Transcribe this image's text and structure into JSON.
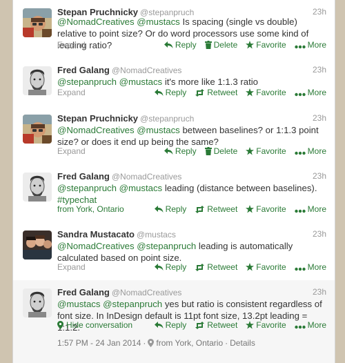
{
  "tweets": [
    {
      "name": "Stepan Pruchnicky",
      "handle": "@stepanpruch",
      "time": "23h",
      "parts": [
        {
          "t": "@NomadCreatives",
          "m": true
        },
        {
          "t": " ",
          "m": false
        },
        {
          "t": "@mustacs",
          "m": true
        },
        {
          "t": " Is spacing (single vs double) relative to point size? Or do word processors use some kind of leading ratio?",
          "m": false
        }
      ],
      "expand": "Expand",
      "actions": [
        "Reply",
        "Delete",
        "Favorite",
        "More"
      ]
    },
    {
      "name": "Fred Galang",
      "handle": "@NomadCreatives",
      "time": "23h",
      "parts": [
        {
          "t": "@stepanpruch",
          "m": true
        },
        {
          "t": " ",
          "m": false
        },
        {
          "t": "@mustacs",
          "m": true
        },
        {
          "t": " it's more like 1:1.3 ratio",
          "m": false
        }
      ],
      "expand": "Expand",
      "actions": [
        "Reply",
        "Retweet",
        "Favorite",
        "More"
      ]
    },
    {
      "name": "Stepan Pruchnicky",
      "handle": "@stepanpruch",
      "time": "23h",
      "parts": [
        {
          "t": "@NomadCreatives",
          "m": true
        },
        {
          "t": " ",
          "m": false
        },
        {
          "t": "@mustacs",
          "m": true
        },
        {
          "t": " between baselines? or 1:1.3 point size? or does it end up being the same?",
          "m": false
        }
      ],
      "expand": "Expand",
      "actions": [
        "Reply",
        "Delete",
        "Favorite",
        "More"
      ]
    },
    {
      "name": "Fred Galang",
      "handle": "@NomadCreatives",
      "time": "23h",
      "parts": [
        {
          "t": "@stepanpruch",
          "m": true
        },
        {
          "t": " ",
          "m": false
        },
        {
          "t": "@mustacs",
          "m": true
        },
        {
          "t": " leading (distance between baselines). ",
          "m": false
        },
        {
          "t": "#typechat",
          "m": true
        }
      ],
      "expand": "from York, Ontario",
      "actions": [
        "Reply",
        "Retweet",
        "Favorite",
        "More"
      ]
    },
    {
      "name": "Sandra Mustacato",
      "handle": "@mustacs",
      "time": "23h",
      "parts": [
        {
          "t": "@NomadCreatives",
          "m": true
        },
        {
          "t": " ",
          "m": false
        },
        {
          "t": "@stepanpruch",
          "m": true
        },
        {
          "t": " leading is automatically calculated based on point size.",
          "m": false
        }
      ],
      "expand": "Expand",
      "actions": [
        "Reply",
        "Retweet",
        "Favorite",
        "More"
      ]
    },
    {
      "name": "Fred Galang",
      "handle": "@NomadCreatives",
      "time": "23h",
      "parts": [
        {
          "t": "@mustacs",
          "m": true
        },
        {
          "t": " ",
          "m": false
        },
        {
          "t": "@stepanpruch",
          "m": true
        },
        {
          "t": " yes but ratio is consistent regardless of font size. In InDesign default is 11pt font size, 13.2pt leading = 1:1.2.",
          "m": false
        }
      ],
      "expand": "Hide conversation",
      "actions": [
        "Reply",
        "Retweet",
        "Favorite",
        "More"
      ],
      "meta": {
        "timestamp": "1:57 PM - 24 Jan 2014",
        "location": "from York, Ontario",
        "details": "Details"
      }
    }
  ],
  "colors": {
    "link": "#2a7a36",
    "muted": "#999999",
    "text": "#333333"
  }
}
